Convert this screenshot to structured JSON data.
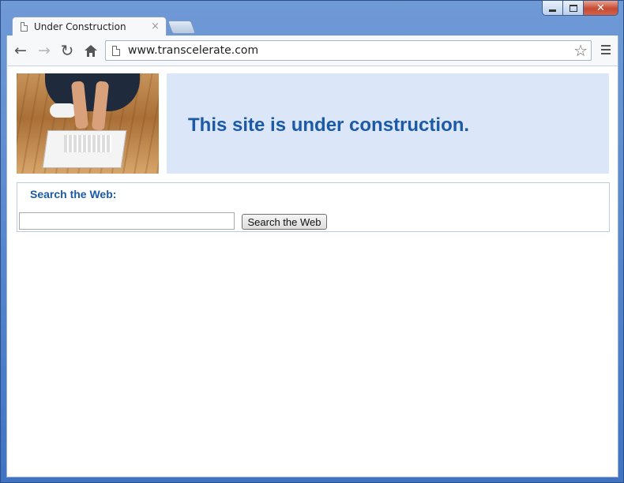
{
  "window": {
    "controls": {
      "minimize_icon": "minimize-icon",
      "maximize_icon": "maximize-icon",
      "close_icon": "close-icon"
    }
  },
  "tabs": [
    {
      "title": "Under Construction",
      "close_glyph": "×",
      "active": true
    }
  ],
  "toolbar": {
    "back_glyph": "←",
    "forward_glyph": "→",
    "reload_glyph": "↻",
    "url": "www.transcelerate.com",
    "star_glyph": "☆"
  },
  "page": {
    "banner_text": "This site is under construction.",
    "search": {
      "heading": "Search the Web:",
      "input_value": "",
      "button_label": "Search the Web"
    }
  },
  "colors": {
    "banner_bg": "#dbe7f8",
    "accent_text": "#1c5aa6",
    "search_border": "#b9cde4"
  }
}
